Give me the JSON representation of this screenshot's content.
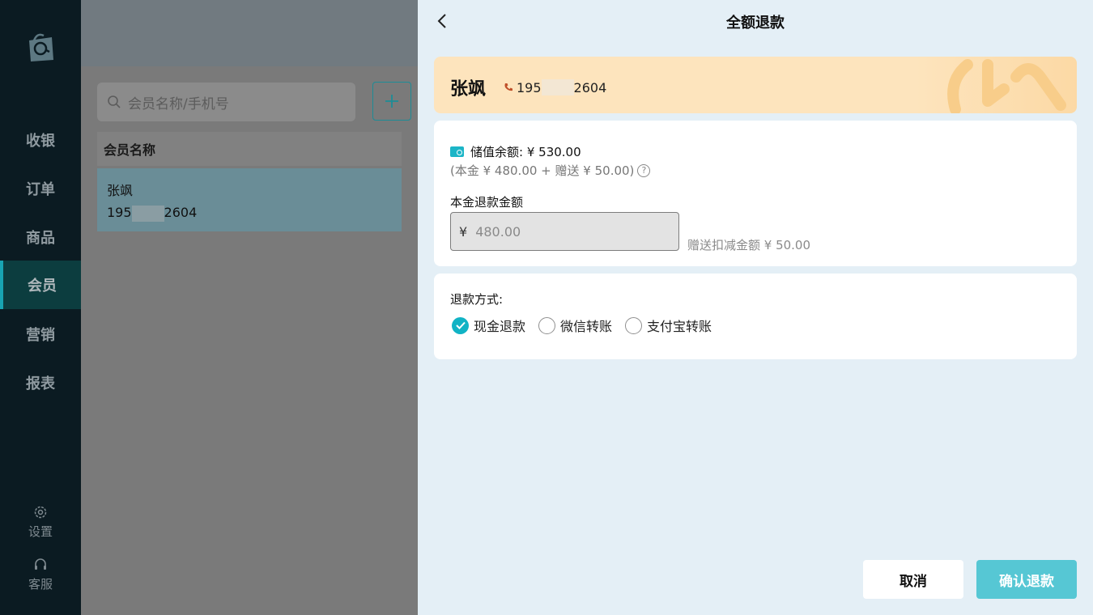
{
  "sidebar": {
    "nav": [
      {
        "label": "收银"
      },
      {
        "label": "订单"
      },
      {
        "label": "商品"
      },
      {
        "label": "会员"
      },
      {
        "label": "营销"
      },
      {
        "label": "报表"
      }
    ],
    "settings_label": "设置",
    "service_label": "客服",
    "active_index": 3
  },
  "member_list": {
    "search_placeholder": "会员名称/手机号",
    "add_icon": "plus-icon",
    "column_header": "会员名称",
    "rows": [
      {
        "name": "张飒",
        "phone_prefix": "195",
        "phone_suffix": "2604"
      }
    ]
  },
  "refund_panel": {
    "title": "全额退款",
    "member": {
      "name": "张飒",
      "phone_prefix": "195",
      "phone_suffix": "2604"
    },
    "balance_label": "储值余额:",
    "balance_value": "¥ 530.00",
    "balance_detail": "(本金 ¥ 480.00 + 赠送 ¥ 50.00)",
    "refund_amount_label": "本金退款金额",
    "currency_symbol": "¥",
    "refund_amount_value": "480.00",
    "bonus_deduct_note": "赠送扣减金额 ¥ 50.00",
    "method_label": "退款方式:",
    "methods": [
      {
        "label": "现金退款",
        "checked": true
      },
      {
        "label": "微信转账",
        "checked": false
      },
      {
        "label": "支付宝转账",
        "checked": false
      }
    ],
    "cancel_label": "取消",
    "confirm_label": "确认退款"
  },
  "colors": {
    "accent": "#11b3c5",
    "confirm_button": "#56c7d4",
    "sidebar_bg": "#0b1b22",
    "member_card_bg": "#fde4bd",
    "panel_bg": "#e4eff6"
  }
}
